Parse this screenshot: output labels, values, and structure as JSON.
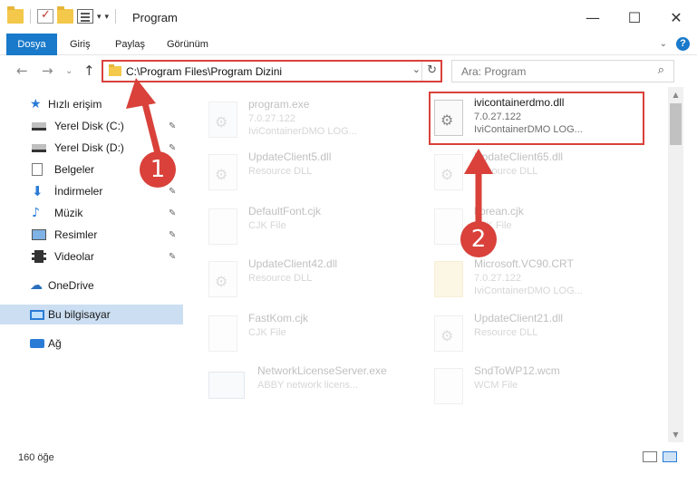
{
  "window": {
    "title": "Program",
    "minimize_icon": "—",
    "maximize_icon": "☐",
    "close_icon": "✕"
  },
  "ribbon": {
    "tabs": [
      "Dosya",
      "Giriş",
      "Paylaş",
      "Görünüm"
    ],
    "collapse_icon": "⌄",
    "help_icon": "?"
  },
  "navigation": {
    "back_icon": "←",
    "forward_icon": "→",
    "recent_icon": "⌄",
    "up_icon": "↑",
    "address": "C:\\Program Files\\Program Dizini",
    "dropdown_icon": "⌄",
    "refresh_icon": "↻",
    "search_placeholder": "Ara: Program",
    "search_icon": "⌕"
  },
  "sidebar": {
    "items": [
      {
        "label": "Hızlı erişim",
        "icon": "star-icon"
      },
      {
        "label": "Yerel Disk (C:)",
        "icon": "disk-icon",
        "pinned": true
      },
      {
        "label": "Yerel Disk (D:)",
        "icon": "disk-icon",
        "pinned": true
      },
      {
        "label": "Belgeler",
        "icon": "documents-icon",
        "pinned": true
      },
      {
        "label": "İndirmeler",
        "icon": "downloads-icon",
        "pinned": true
      },
      {
        "label": "Müzik",
        "icon": "music-icon",
        "pinned": true
      },
      {
        "label": "Resimler",
        "icon": "pictures-icon",
        "pinned": true
      },
      {
        "label": "Videolar",
        "icon": "videos-icon",
        "pinned": true
      },
      {
        "label": "OneDrive",
        "icon": "cloud-icon"
      },
      {
        "label": "Bu bilgisayar",
        "icon": "computer-icon",
        "selected": true
      },
      {
        "label": "Ağ",
        "icon": "network-icon"
      }
    ],
    "pin_icon": "📌"
  },
  "files": [
    {
      "name": "program.exe",
      "line1": "7.0.27.122",
      "line2": "IviContainerDMO LOG...",
      "faded": true
    },
    {
      "name": "ivicontainerdmo.dll",
      "line1": "7.0.27.122",
      "line2": "IviContainerDMO LOG...",
      "faded": false,
      "highlighted": true
    },
    {
      "name": "UpdateClient5.dll",
      "line1": "Resource DLL",
      "line2": "",
      "faded": true
    },
    {
      "name": "UpdateClient65.dll",
      "line1": "Resource DLL",
      "line2": "",
      "faded": true
    },
    {
      "name": "DefaultFont.cjk",
      "line1": "CJK File",
      "line2": "",
      "faded": true
    },
    {
      "name": "korean.cjk",
      "line1": "CJK File",
      "line2": "",
      "faded": true
    },
    {
      "name": "UpdateClient42.dll",
      "line1": "Resource DLL",
      "line2": "",
      "faded": true
    },
    {
      "name": "Microsoft.VC90.CRT",
      "line1": "7.0.27.122",
      "line2": "IviContainerDMO LOG...",
      "faded": true
    },
    {
      "name": "FastKom.cjk",
      "line1": "CJK File",
      "line2": "",
      "faded": true
    },
    {
      "name": "UpdateClient21.dll",
      "line1": "Resource DLL",
      "line2": "",
      "faded": true
    },
    {
      "name": "NetworkLicenseServer.exe",
      "line1": "ABBY network licens...",
      "line2": "",
      "faded": true
    },
    {
      "name": "SndToWP12.wcm",
      "line1": "WCM File",
      "line2": "",
      "faded": true
    }
  ],
  "annotations": {
    "step1": "1",
    "step2": "2",
    "accent_color": "#d9413a"
  },
  "status": {
    "item_count": "160 öğe"
  },
  "colors": {
    "file_tab": "#1979ca",
    "selected": "#ccdff2",
    "annotation": "#d9413a"
  }
}
